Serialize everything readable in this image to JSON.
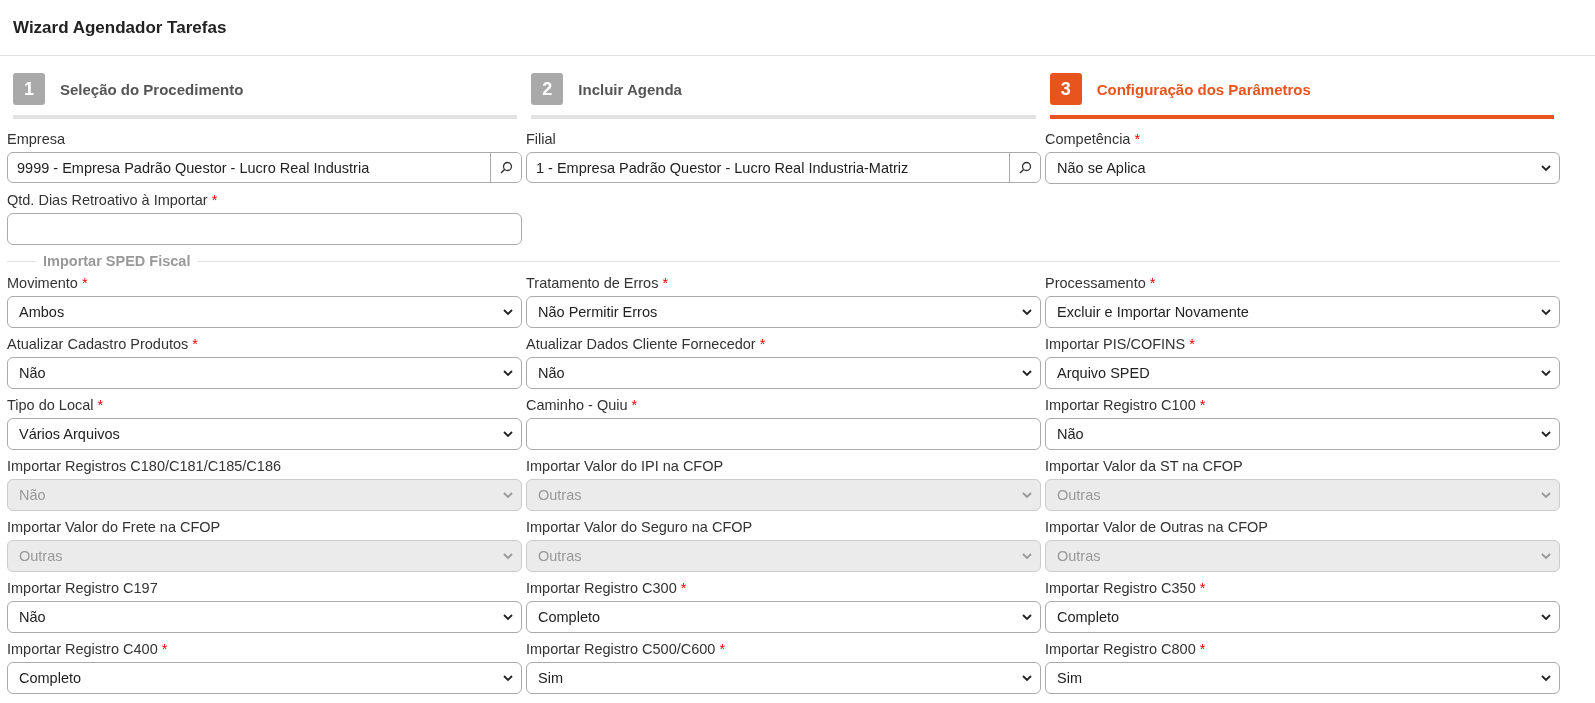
{
  "window": {
    "title": "Wizard Agendador Tarefas"
  },
  "steps": [
    {
      "number": "1",
      "label": "Seleção do Procedimento",
      "selected": false
    },
    {
      "number": "2",
      "label": "Incluir Agenda",
      "selected": false
    },
    {
      "number": "3",
      "label": "Configuração dos Parâmetros",
      "selected": true
    }
  ],
  "top_fields": [
    {
      "kind": "lookup",
      "label": "Empresa",
      "value": "9999 - Empresa Padrão Questor - Lucro Real Industria",
      "disabled": false
    },
    {
      "kind": "lookup",
      "label": "Filial",
      "value": "1 - Empresa Padrão Questor - Lucro Real Industria-Matriz",
      "disabled": false
    },
    {
      "kind": "select",
      "label": "Competência",
      "required_mark": "*",
      "value": "Não se Aplica",
      "disabled": false
    },
    {
      "kind": "text",
      "label": "Qtd. Dias Retroativo à Importar",
      "required_mark": "*",
      "disabled": false
    }
  ],
  "section": {
    "title": "Importar SPED Fiscal",
    "fields": [
      {
        "kind": "select",
        "label": "Movimento",
        "required_mark": "*",
        "value": "Ambos",
        "disabled": false
      },
      {
        "kind": "select",
        "label": "Tratamento de Erros",
        "required_mark": "*",
        "value": "Não Permitir Erros",
        "disabled": false
      },
      {
        "kind": "select",
        "label": "Processamento",
        "required_mark": "*",
        "value": "Excluir e Importar Novamente",
        "disabled": false
      },
      {
        "kind": "select",
        "label": "Atualizar Cadastro Produtos",
        "required_mark": "*",
        "value": "Não",
        "disabled": false
      },
      {
        "kind": "select",
        "label": "Atualizar Dados Cliente Fornecedor",
        "required_mark": "*",
        "value": "Não",
        "disabled": false
      },
      {
        "kind": "select",
        "label": "Importar PIS/COFINS",
        "required_mark": "*",
        "value": "Arquivo SPED",
        "disabled": false
      },
      {
        "kind": "select",
        "label": "Tipo do Local",
        "required_mark": "*",
        "value": "Vários Arquivos",
        "disabled": false
      },
      {
        "kind": "text",
        "label": "Caminho - Quiu",
        "required_mark": "*",
        "disabled": false
      },
      {
        "kind": "select",
        "label": "Importar Registro C100",
        "required_mark": "*",
        "value": "Não",
        "disabled": false
      },
      {
        "kind": "select",
        "label": "Importar Registros C180/C181/C185/C186",
        "value": "Não",
        "disabled": true
      },
      {
        "kind": "select",
        "label": "Importar Valor do IPI na CFOP",
        "value": "Outras",
        "disabled": true
      },
      {
        "kind": "select",
        "label": "Importar Valor da ST na CFOP",
        "value": "Outras",
        "disabled": true
      },
      {
        "kind": "select",
        "label": "Importar Valor do Frete na CFOP",
        "value": "Outras",
        "disabled": true
      },
      {
        "kind": "select",
        "label": "Importar Valor do Seguro na CFOP",
        "value": "Outras",
        "disabled": true
      },
      {
        "kind": "select",
        "label": "Importar Valor de Outras na CFOP",
        "value": "Outras",
        "disabled": true
      },
      {
        "kind": "select",
        "label": "Importar Registro C197",
        "value": "Não",
        "disabled": false
      },
      {
        "kind": "select",
        "label": "Importar Registro C300",
        "required_mark": "*",
        "value": "Completo",
        "disabled": false
      },
      {
        "kind": "select",
        "label": "Importar Registro C350",
        "required_mark": "*",
        "value": "Completo",
        "disabled": false
      },
      {
        "kind": "select",
        "label": "Importar Registro C400",
        "required_mark": "*",
        "value": "Completo",
        "disabled": false
      },
      {
        "kind": "select",
        "label": "Importar Registro C500/C600",
        "required_mark": "*",
        "value": "Sim",
        "disabled": false
      },
      {
        "kind": "select",
        "label": "Importar Registro C800",
        "required_mark": "*",
        "value": "Sim",
        "disabled": false
      }
    ]
  }
}
